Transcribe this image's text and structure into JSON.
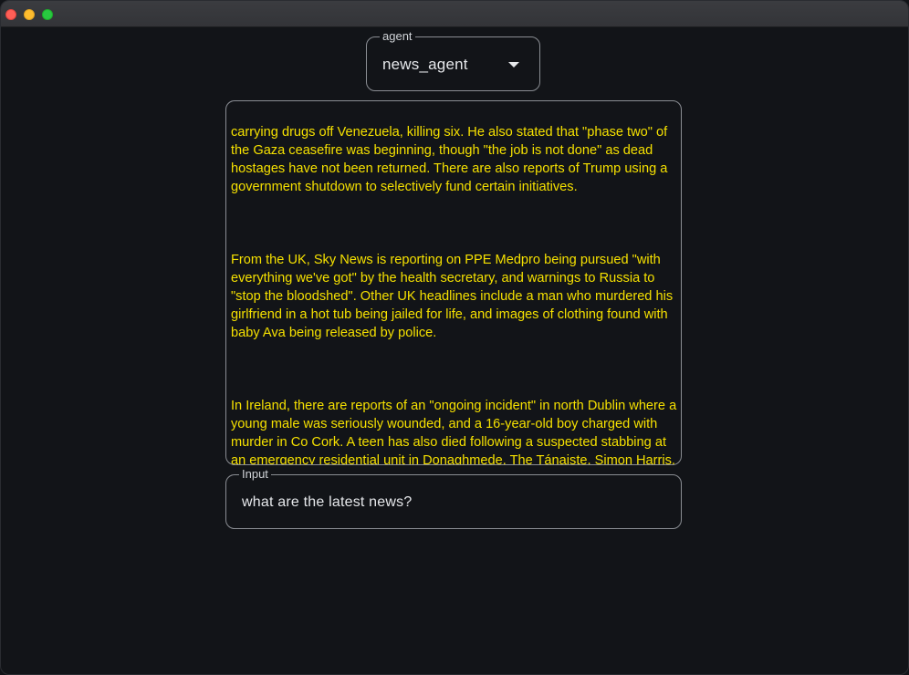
{
  "agent_select": {
    "label": "agent",
    "value": "news_agent"
  },
  "output": {
    "paragraphs": [
      "carrying drugs off Venezuela, killing six. He also stated that \"phase two\" of the Gaza ceasefire was beginning, though \"the job is not done\" as dead hostages have not been returned. There are also reports of Trump using a government shutdown to selectively fund certain initiatives.",
      "From the UK, Sky News is reporting on PPE Medpro being pursued \"with everything we've got\" by the health secretary, and warnings to Russia to \"stop the bloodshed\". Other UK headlines include a man who murdered his girlfriend in a hot tub being jailed for life, and images of clothing found with baby Ava being released by police.",
      "In Ireland, there are reports of an \"ongoing incident\" in north Dublin where a young male was seriously wounded, and a 16-year-old boy charged with murder in Co Cork. A teen has also died following a suspected stabbing at an emergency residential unit in Donaghmede. The Tánaiste, Simon Harris, won a confidence motion amidst accusations of a \"cheap cynical trick\". Additionally, 29 Paddy Power shops across Ireland are set to close due to \"challenging\" market conditions."
    ],
    "text_color": "#f5e000"
  },
  "input": {
    "label": "Input",
    "value": "what are the latest news?"
  },
  "colors": {
    "background": "#121418",
    "border": "#8a8d93",
    "text": "#e6e8eb"
  }
}
